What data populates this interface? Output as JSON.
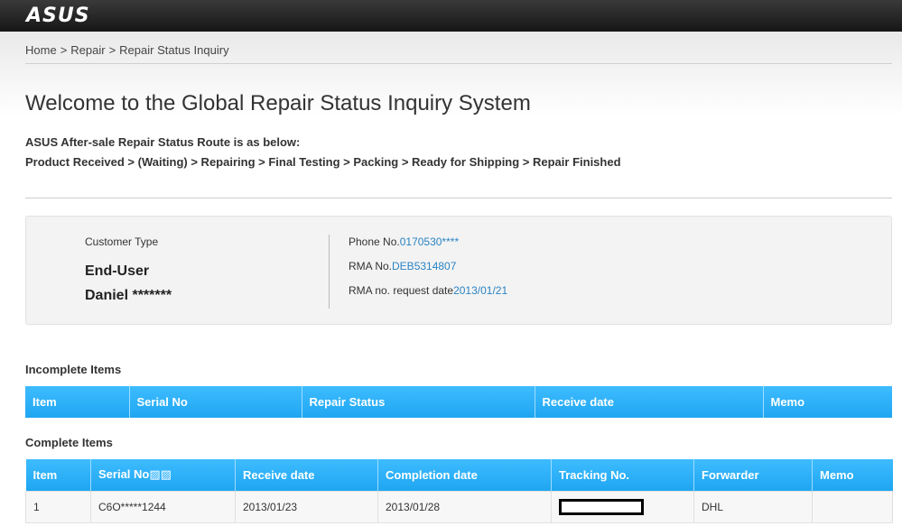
{
  "header": {
    "logo_text": "ASUS"
  },
  "breadcrumb": {
    "items": [
      "Home",
      "Repair",
      "Repair Status Inquiry"
    ],
    "separator": ">"
  },
  "page": {
    "title": "Welcome to the Global Repair Status Inquiry System",
    "route_heading": "ASUS After-sale Repair Status Route is as below:",
    "route_steps": "Product Received > (Waiting) > Repairing > Final Testing > Packing > Ready for Shipping > Repair Finished"
  },
  "customer": {
    "type_label": "Customer Type",
    "type_value": "End-User",
    "name": "Daniel *******",
    "phone_label": "Phone No.",
    "phone_value": "0170530****",
    "rma_label": "RMA No.",
    "rma_value": "DEB5314807",
    "rma_date_label": "RMA no. request date",
    "rma_date_value": "2013/01/21"
  },
  "incomplete": {
    "title": "Incomplete Items",
    "headers": [
      "Item",
      "Serial No",
      "Repair Status",
      "Receive date",
      "Memo"
    ]
  },
  "complete": {
    "title": "Complete Items",
    "headers": [
      "Item",
      "Serial No▨▨",
      "Receive date",
      "Completion date",
      "Tracking No.",
      "Forwarder",
      "Memo"
    ],
    "rows": [
      {
        "item": "1",
        "serial": "C6O*****1244",
        "receive": "2013/01/23",
        "completion": "2013/01/28",
        "tracking": "",
        "forwarder": "DHL",
        "memo": ""
      }
    ]
  },
  "colors": {
    "header_bar": "#1b1b1b",
    "table_header": "#27aef5",
    "link": "#2a84c4"
  }
}
